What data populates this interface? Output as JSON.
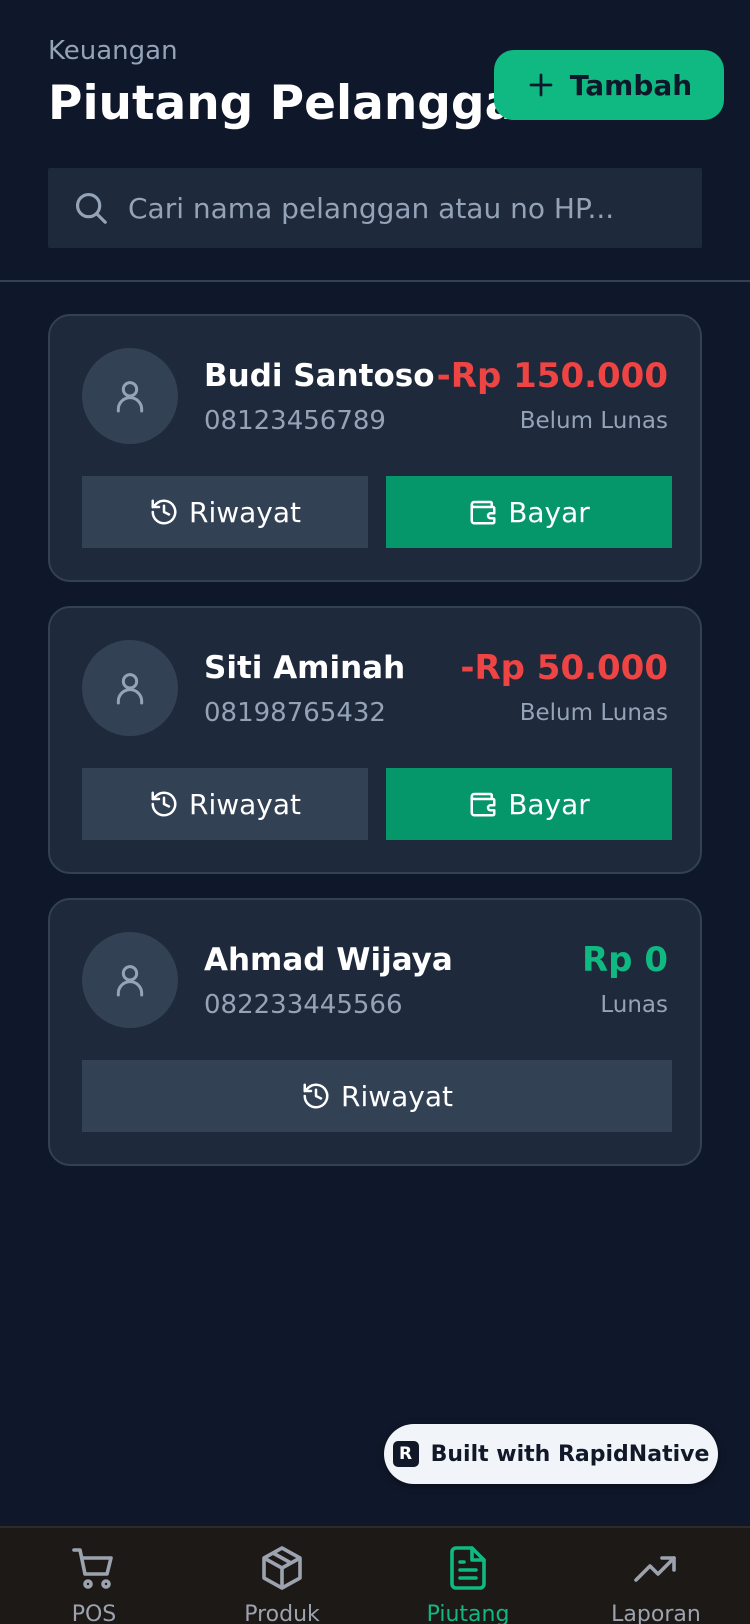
{
  "header": {
    "eyebrow": "Keuangan",
    "title": "Piutang Pelanggan",
    "add_label": "Tambah"
  },
  "search": {
    "placeholder": "Cari nama pelanggan atau no HP...",
    "value": ""
  },
  "customers": [
    {
      "name": "Budi Santoso",
      "phone": "08123456789",
      "amount": "-Rp 150.000",
      "status": "Belum Lunas",
      "history_label": "Riwayat",
      "pay_label": "Bayar"
    },
    {
      "name": "Siti Aminah",
      "phone": "08198765432",
      "amount": "-Rp 50.000",
      "status": "Belum Lunas",
      "history_label": "Riwayat",
      "pay_label": "Bayar"
    },
    {
      "name": "Ahmad Wijaya",
      "phone": "082233445566",
      "amount": "Rp 0",
      "status": "Lunas",
      "history_label": "Riwayat"
    }
  ],
  "badge": {
    "logo": "R",
    "text": "Built with RapidNative"
  },
  "nav": {
    "items": [
      {
        "label": "POS",
        "icon": "cart-icon",
        "active": false
      },
      {
        "label": "Produk",
        "icon": "box-icon",
        "active": false
      },
      {
        "label": "Piutang",
        "icon": "document-icon",
        "active": true
      },
      {
        "label": "Laporan",
        "icon": "trending-up-icon",
        "active": false
      }
    ]
  },
  "colors": {
    "background": "#0f172a",
    "card": "#1e293b",
    "accent": "#10b981",
    "pay_button": "#059669",
    "debt": "#ef4444",
    "muted": "#94a3b8"
  }
}
